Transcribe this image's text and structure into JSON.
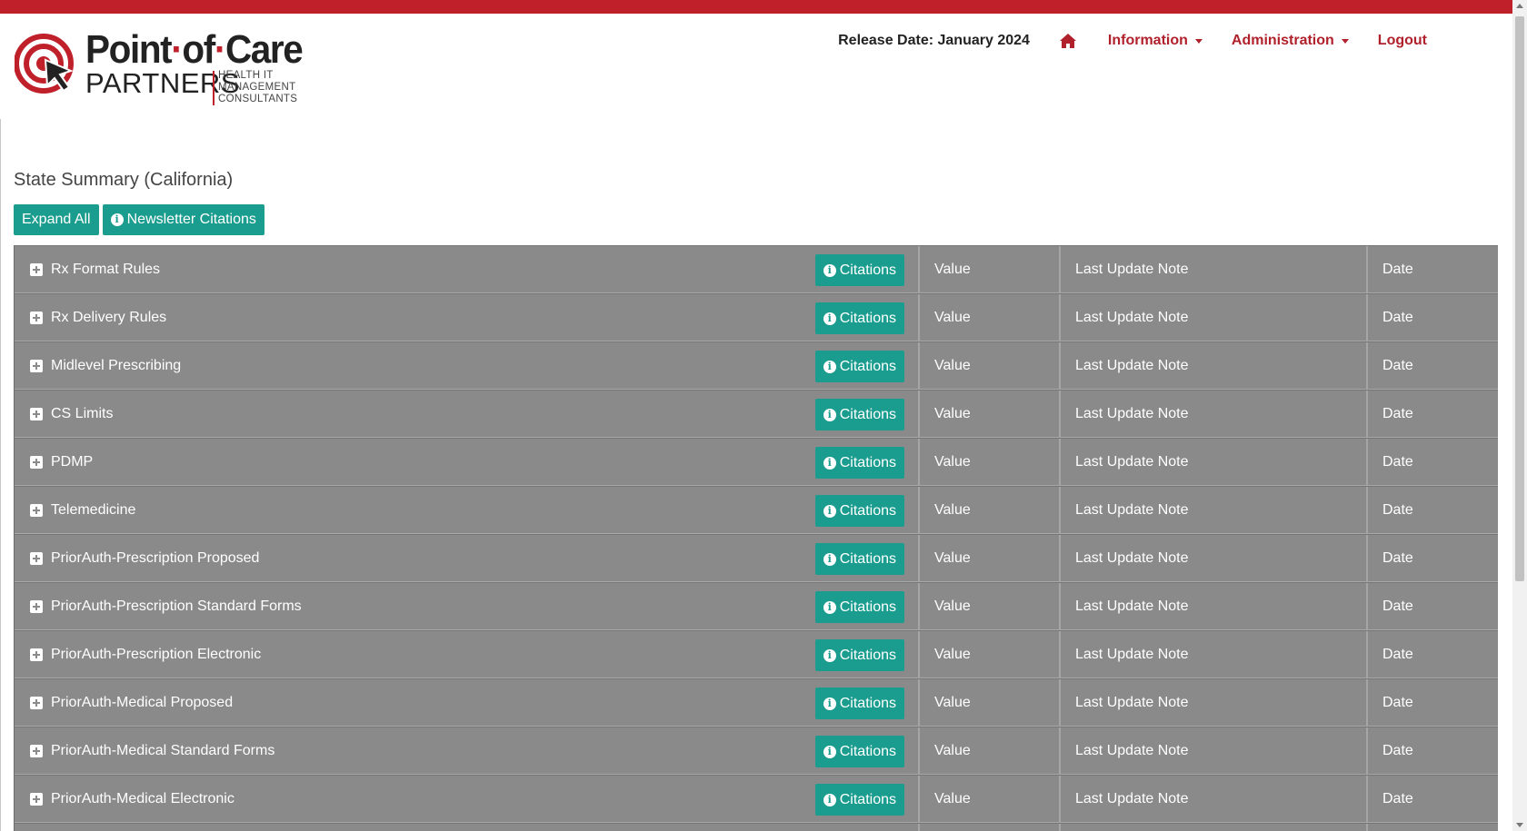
{
  "header": {
    "brand_line1_a": "Point",
    "brand_line1_dot": "·",
    "brand_line1_b": "of",
    "brand_line1_c": "Care",
    "brand_line2": "PARTNERS",
    "brand_tag": [
      "HEALTH IT",
      "MANAGEMENT",
      "CONSULTANTS"
    ],
    "release": "Release Date: January 2024",
    "nav": {
      "home_icon": "home-icon",
      "information": "Information",
      "administration": "Administration",
      "logout": "Logout"
    }
  },
  "page": {
    "title": "State Summary (California)",
    "expand_all": "Expand All",
    "newsletter_citations": "Newsletter Citations"
  },
  "colors": {
    "brand_red": "#c0202a",
    "accent_teal": "#1a9d8f",
    "row_gray": "#8a8a8a"
  },
  "table": {
    "citations_label": "Citations",
    "value_label": "Value",
    "note_label": "Last Update Note",
    "date_label": "Date",
    "rows": [
      "Rx Format Rules",
      "Rx Delivery Rules",
      "Midlevel Prescribing",
      "CS Limits",
      "PDMP",
      "Telemedicine",
      "PriorAuth-Prescription Proposed",
      "PriorAuth-Prescription Standard Forms",
      "PriorAuth-Prescription Electronic",
      "PriorAuth-Medical Proposed",
      "PriorAuth-Medical Standard Forms",
      "PriorAuth-Medical Electronic"
    ]
  }
}
